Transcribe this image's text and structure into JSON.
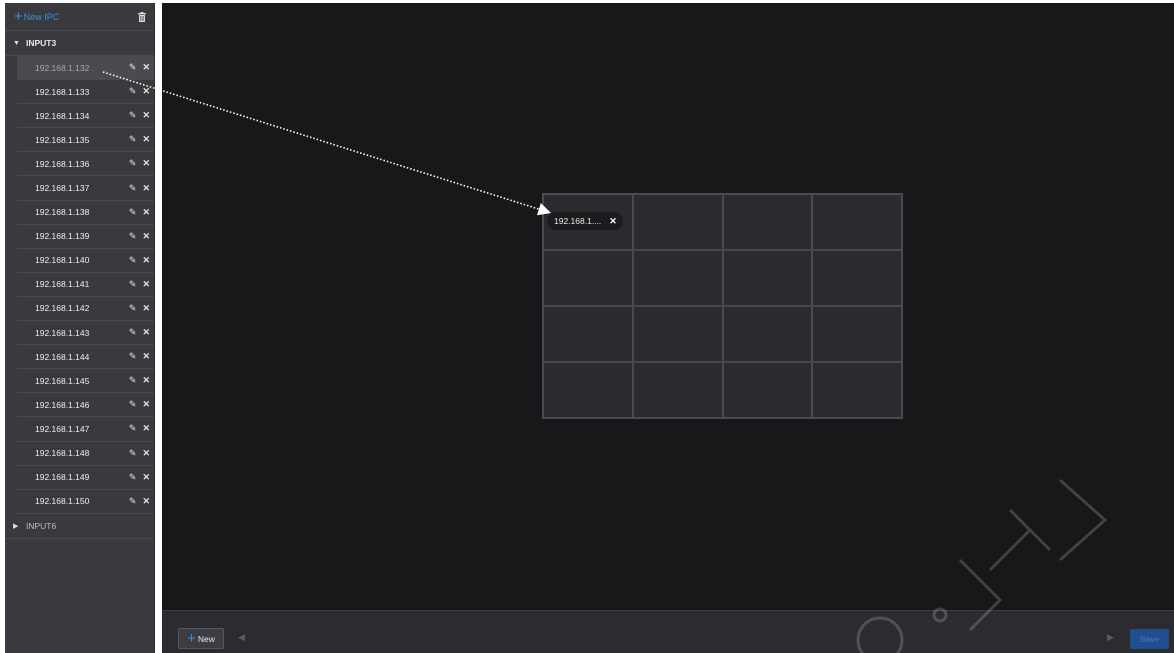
{
  "sidebar": {
    "new_ipc_label": "New IPC",
    "groups": [
      {
        "label": "INPUT3",
        "expanded": true,
        "items": [
          {
            "ip": "192.168.1.132",
            "selected": true
          },
          {
            "ip": "192.168.1.133"
          },
          {
            "ip": "192.168.1.134"
          },
          {
            "ip": "192.168.1.135"
          },
          {
            "ip": "192.168.1.136"
          },
          {
            "ip": "192.168.1.137"
          },
          {
            "ip": "192.168.1.138"
          },
          {
            "ip": "192.168.1.139"
          },
          {
            "ip": "192.168.1.140"
          },
          {
            "ip": "192.168.1.141"
          },
          {
            "ip": "192.168.1.142"
          },
          {
            "ip": "192.168.1.143"
          },
          {
            "ip": "192.168.1.144"
          },
          {
            "ip": "192.168.1.145"
          },
          {
            "ip": "192.168.1.146"
          },
          {
            "ip": "192.168.1.147"
          },
          {
            "ip": "192.168.1.148"
          },
          {
            "ip": "192.168.1.149"
          },
          {
            "ip": "192.168.1.150"
          }
        ]
      },
      {
        "label": "INPUT6",
        "expanded": false,
        "items": []
      }
    ]
  },
  "layout_grid": {
    "rows": 4,
    "cols": 4,
    "assigned": [
      {
        "cell": 0,
        "label": "192.168.1...."
      }
    ]
  },
  "bottom_bar": {
    "new_label": "New",
    "save_label": "Save"
  },
  "colors": {
    "accent": "#3b8fe0",
    "sidebar_bg": "#3a3a3e",
    "canvas_bg": "#18181b",
    "save_bg": "#1f4f8f"
  }
}
